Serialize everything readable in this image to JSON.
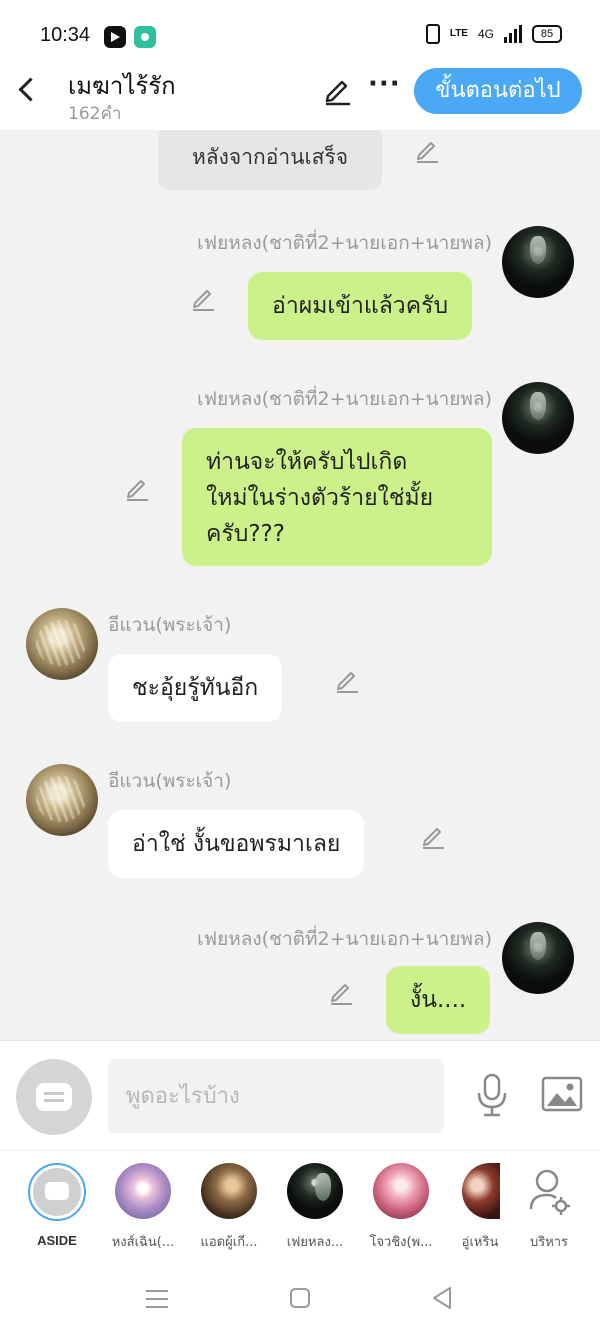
{
  "status_bar": {
    "time": "10:34",
    "lte": "LTE",
    "network": "4G",
    "battery": "85"
  },
  "header": {
    "title": "เมฆาไร้รัก",
    "word_count": "162คำ",
    "next_label": "ขั้นตอนต่อไป"
  },
  "narration": "หลังจากอ่านเสร็จ",
  "messages": [
    {
      "side": "right",
      "sender": "เฟยหลง(ชาติที่2+นายเอก+นายพล)",
      "text": "อ่าผมเข้าแล้วครับ"
    },
    {
      "side": "right",
      "sender": "เฟยหลง(ชาติที่2+นายเอก+นายพล)",
      "lines": [
        "ท่านจะให้ครับไปเกิด",
        "ใหม่ในร่างตัวร้ายใช่มั้ย",
        "ครับ???"
      ]
    },
    {
      "side": "left",
      "sender": "อีแวน(พระเจ้า)",
      "text": "ชะอุ้ยรู้ทันอีก"
    },
    {
      "side": "left",
      "sender": "อีแวน(พระเจ้า)",
      "text": "อ่าใช่ งั้นขอพรมาเลย"
    },
    {
      "side": "right",
      "sender": "เฟยหลง(ชาติที่2+นายเอก+นายพล)",
      "text": "งั้น...."
    }
  ],
  "input": {
    "placeholder": "พูดอะไรบ้าง"
  },
  "characters": [
    {
      "label": "ASIDE"
    },
    {
      "label": "หงส์เฉิน(..."
    },
    {
      "label": "แอดผู้เกี..."
    },
    {
      "label": "เฟยหลง..."
    },
    {
      "label": "โจวชิง(พ..."
    },
    {
      "label": "อู่เหริน"
    },
    {
      "label": "บริหาร"
    }
  ],
  "colors": {
    "accent": "#4aa8f5",
    "bubble_self": "#cdf18a",
    "bubble_other": "#ffffff",
    "background": "#f2f2f2"
  }
}
